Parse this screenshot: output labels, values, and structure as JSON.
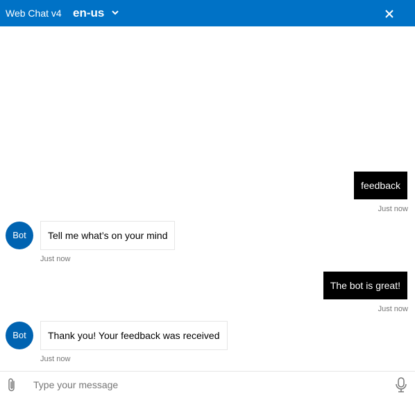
{
  "header": {
    "title": "Web Chat v4",
    "locale": "en-us",
    "icons": {
      "locale_dropdown": "chevron-down-icon",
      "close": "close-icon"
    },
    "background_color": "#0072c6"
  },
  "messages": [
    {
      "from": "user",
      "text": "feedback",
      "timestamp": "Just now"
    },
    {
      "from": "bot",
      "avatar": "Bot",
      "text": "Tell me what’s on your mind",
      "timestamp": "Just now"
    },
    {
      "from": "user",
      "text": "The bot is great!",
      "timestamp": "Just now"
    },
    {
      "from": "bot",
      "avatar": "Bot",
      "text": "Thank you! Your feedback was received",
      "timestamp": "Just now"
    }
  ],
  "sendbox": {
    "placeholder": "Type your message",
    "icons": {
      "attach": "paperclip-icon",
      "microphone": "microphone-icon"
    }
  },
  "colors": {
    "user_bubble": "#000000",
    "bot_avatar": "#0063b1",
    "timestamp": "#767676"
  }
}
